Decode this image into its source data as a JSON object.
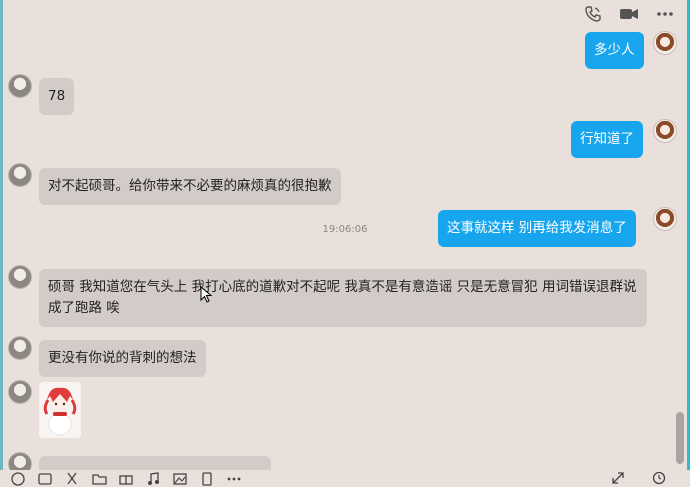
{
  "header": {
    "icons": [
      "phone-icon",
      "video-icon",
      "more-icon"
    ]
  },
  "messages": [
    {
      "side": "out",
      "text": "多少人"
    },
    {
      "side": "in",
      "text": "78"
    },
    {
      "side": "out",
      "text": "行知道了"
    },
    {
      "side": "in",
      "text": "对不起硕哥。给你带来不必要的麻烦真的很抱歉"
    },
    {
      "side": "out",
      "text": "这事就这样 别再给我发消息了"
    },
    {
      "side": "in",
      "text": "硕哥 我知道您在气头上 我打心底的道歉对不起呢 我真不是有意造谣 只是无意冒犯 用词错误退群说成了跑路 唉"
    },
    {
      "side": "in",
      "text": "更没有你说的背刺的想法"
    }
  ],
  "timestamp": "19:06:06",
  "toolbar": {
    "icons": [
      "emoji-icon",
      "gif-icon",
      "scissors-icon",
      "folder-icon",
      "gift-icon",
      "music-icon",
      "image-icon",
      "screen-icon",
      "more-horizontal-icon"
    ],
    "right_icons": [
      "expand-icon",
      "history-icon"
    ]
  },
  "colors": {
    "background": "#e9e0dc",
    "incoming_bubble": "#d2cbc7",
    "outgoing_bubble": "#17a6ee"
  }
}
